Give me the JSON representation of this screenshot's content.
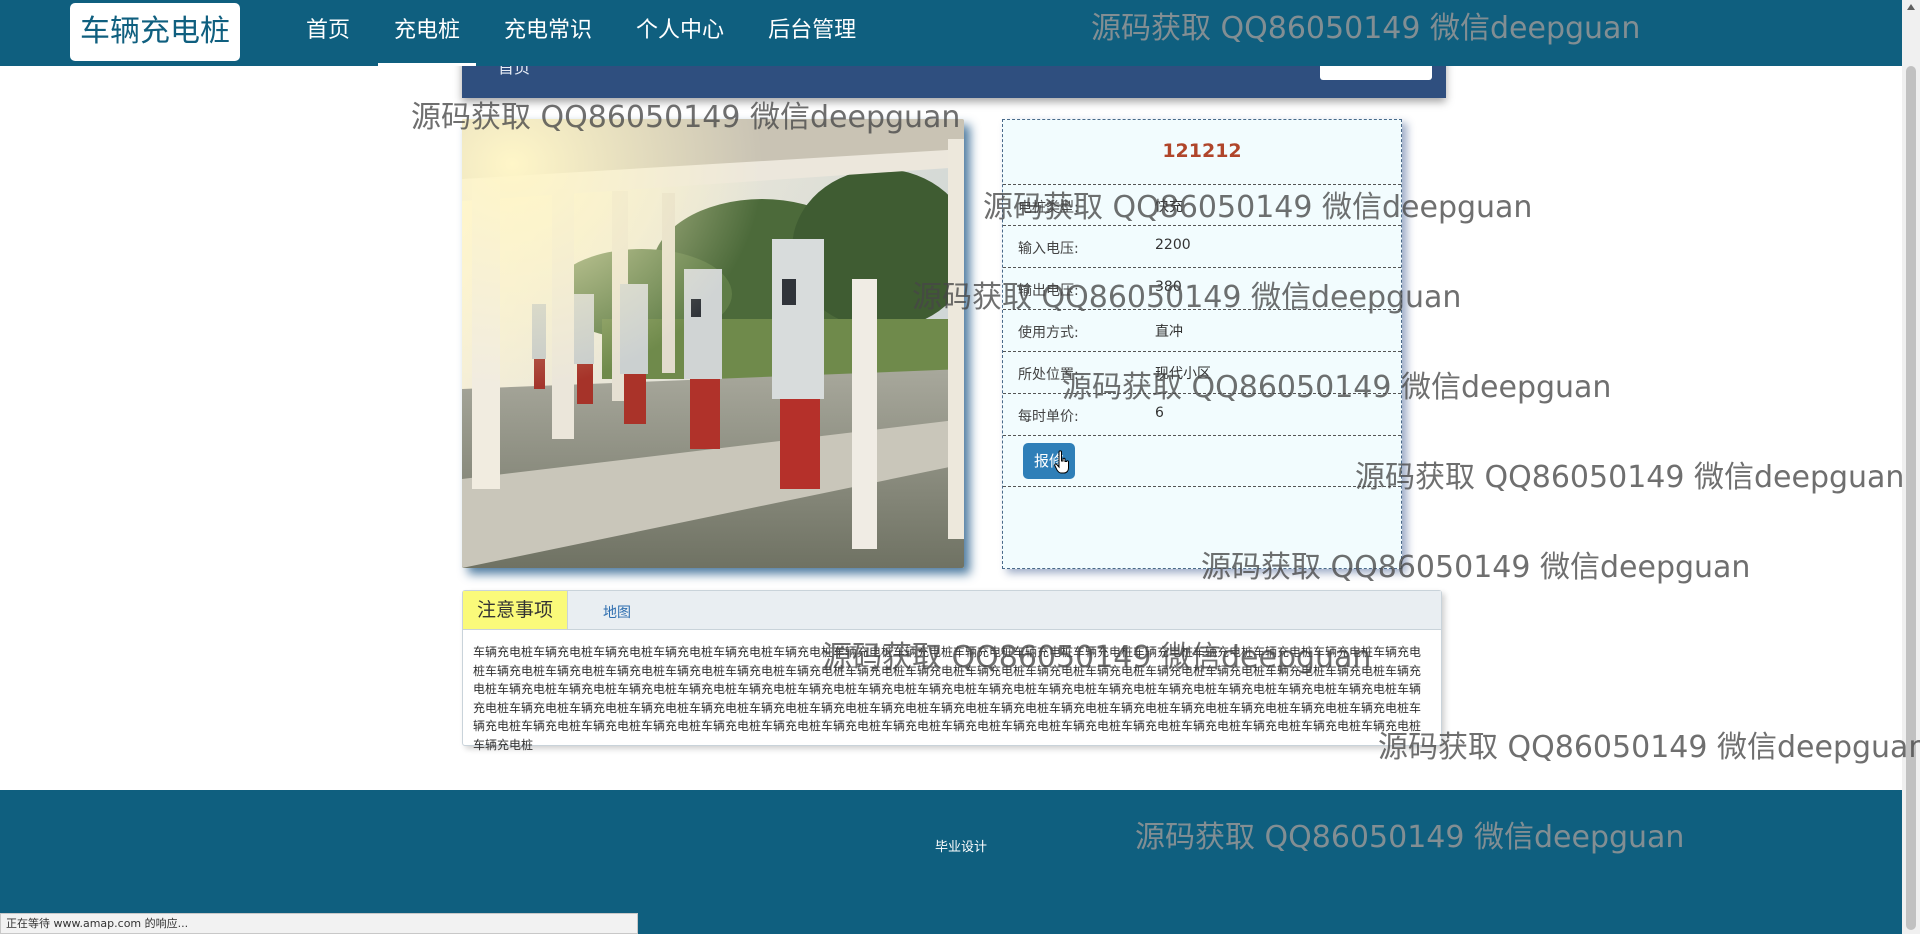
{
  "brand": {
    "title": "车辆充电桩"
  },
  "nav": {
    "items": [
      "首页",
      "充电桩",
      "充电常识",
      "个人中心",
      "后台管理"
    ],
    "active_index": 1
  },
  "breadcrumb": {
    "text": "首页"
  },
  "detail": {
    "title": "121212",
    "fields": [
      {
        "label": "电桩类型:",
        "value": "快充"
      },
      {
        "label": "输入电压:",
        "value": "2200"
      },
      {
        "label": "输出电压:",
        "value": "380"
      },
      {
        "label": "使用方式:",
        "value": "直冲"
      },
      {
        "label": "所处位置:",
        "value": "现代小区"
      },
      {
        "label": "每时单价:",
        "value": "6"
      }
    ],
    "report_button": "报修"
  },
  "tabs": {
    "active": "注意事项",
    "map": "地图",
    "content": "车辆充电桩车辆充电桩车辆充电桩车辆充电桩车辆充电桩车辆充电桩车辆充电桩车辆充电桩车辆充电桩车辆充电桩车辆充电桩车辆充电桩车辆充电桩车辆充电桩车辆充电桩车辆充电桩车辆充电桩车辆充电桩车辆充电桩车辆充电桩车辆充电桩车辆充电桩车辆充电桩车辆充电桩车辆充电桩车辆充电桩车辆充电桩车辆充电桩车辆充电桩车辆充电桩车辆充电桩车辆充电桩车辆充电桩车辆充电桩车辆充电桩车辆充电桩车辆充电桩车辆充电桩车辆充电桩车辆充电桩车辆充电桩车辆充电桩车辆充电桩车辆充电桩车辆充电桩车辆充电桩车辆充电桩车辆充电桩车辆充电桩车辆充电桩车辆充电桩车辆充电桩车辆充电桩车辆充电桩车辆充电桩车辆充电桩车辆充电桩车辆充电桩车辆充电桩车辆充电桩车辆充电桩车辆充电桩车辆充电桩车辆充电桩车辆充电桩车辆充电桩车辆充电桩车辆充电桩车辆充电桩车辆充电桩车辆充电桩车辆充电桩车辆充电桩车辆充电桩车辆充电桩车辆充电桩车辆充电桩车辆充电桩车辆充电桩车辆充电桩"
  },
  "footer": {
    "text": "毕业设计"
  },
  "status_bar": {
    "text": "正在等待 www.amap.com 的响应..."
  },
  "watermark": {
    "text": "源码获取 QQ86050149 微信deepguan"
  },
  "colors": {
    "header": "#0f5f7f",
    "breadcrumb_bar": "#2f4f7f",
    "panel_bg": "#f2fcfe",
    "title_red": "#b0452a",
    "tab_active_bg": "#fafa7a",
    "button_blue": "#2f7fb8"
  }
}
